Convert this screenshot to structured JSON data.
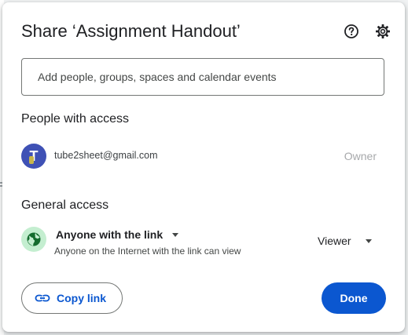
{
  "dialog": {
    "title": "Share ‘Assignment Handout’",
    "help_icon": "help-circle-icon",
    "settings_icon": "gear-icon"
  },
  "add_people": {
    "placeholder": "Add people, groups, spaces and calendar events"
  },
  "people_with_access": {
    "heading": "People with access",
    "people": [
      {
        "avatar_letter": "T",
        "email": "tube2sheet@gmail.com",
        "role": "Owner"
      }
    ]
  },
  "general_access": {
    "heading": "General access",
    "setting": "Anyone with the link",
    "description": "Anyone on the Internet with the link can view",
    "role": "Viewer",
    "icon": "globe-icon"
  },
  "footer": {
    "copy_link_label": "Copy link",
    "copy_link_icon": "link-icon",
    "done_label": "Done"
  },
  "colors": {
    "primary": "#0b57d0",
    "avatar_bg": "#3f51b5",
    "globe_bg": "#c4eed0"
  }
}
